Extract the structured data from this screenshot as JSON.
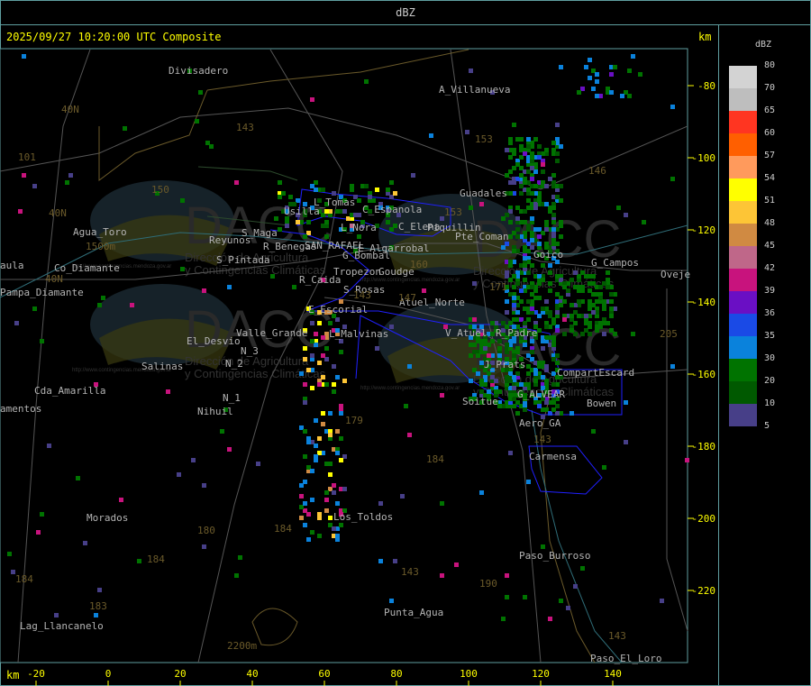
{
  "header": {
    "title": "dBZ"
  },
  "map": {
    "timestamp": "2025/09/27 10:20:00 UTC Composite",
    "unit_top": "km",
    "unit_bottom": "km",
    "x_ticks": [
      "-20",
      "0",
      "20",
      "40",
      "60",
      "80",
      "100",
      "120",
      "140"
    ],
    "y_ticks": [
      "-80",
      "-100",
      "-120",
      "-140",
      "-160",
      "-180",
      "-200",
      "-220"
    ],
    "watermark": {
      "logo": "DACC",
      "line1": "Dirección de Agricultura",
      "line2": "y Contingencias Climáticas",
      "url": "http://www.contingencias.mendoza.gov.ar"
    },
    "places": [
      "Divisadero",
      "A_Villanueva",
      "40N",
      "101",
      "143",
      "153",
      "146",
      "150",
      "Guadales",
      "40N",
      "40N",
      "Agua_Toro",
      "1500m",
      "Reyunos",
      "L_Nora",
      "C_Espanola",
      "Usilla",
      "L_Tomas",
      "C_Elena",
      "Piquillin",
      "Pte_Coman",
      "SAN_RAFAEL",
      "E_Algarrobal",
      "G_Bombal",
      "R_Benegas",
      "S_Pintada",
      "Tropezon",
      "Goudge",
      "R_Caida",
      "S_Rosas",
      "G_Campos",
      "Oveje",
      "Atuel_Norte",
      "E_Escorial",
      "Valle_Grande",
      "L_Malvinas",
      "El_Desvio",
      "V_Atuel",
      "R_Padre",
      "J_Prats",
      "CompartEscard",
      "Salinas",
      "N_2",
      "N_3",
      "N_1",
      "Nihuil",
      "Cda_Amarilla",
      "amentos",
      "Pampa_Diamante",
      "aula",
      "Co_Diamante",
      "Soitue",
      "G_ALVEAR",
      "Bowen",
      "Aero_GA",
      "Carmensa",
      "Los_Toldos",
      "Morados",
      "Paso_Burroso",
      "Punta_Agua",
      "Lag_Llancanelo",
      "2200m",
      "Paso_El_Loro",
      "179",
      "184",
      "180",
      "184",
      "184",
      "183",
      "143",
      "143",
      "190",
      "143",
      "184",
      "205",
      "160",
      "171",
      "147",
      "143",
      "153",
      "Goico",
      "S_Maga"
    ]
  },
  "legend": {
    "title": "dBZ",
    "items": [
      {
        "label": "80",
        "color": "#d3d3d3"
      },
      {
        "label": "70",
        "color": "#bebebe"
      },
      {
        "label": "65",
        "color": "#ff3521"
      },
      {
        "label": "60",
        "color": "#ff5f00"
      },
      {
        "label": "57",
        "color": "#ff9a5c"
      },
      {
        "label": "54",
        "color": "#ffff00"
      },
      {
        "label": "51",
        "color": "#fdc536"
      },
      {
        "label": "48",
        "color": "#d08a42"
      },
      {
        "label": "45",
        "color": "#bf6789"
      },
      {
        "label": "42",
        "color": "#c8137d"
      },
      {
        "label": "39",
        "color": "#6a0fc4"
      },
      {
        "label": "36",
        "color": "#1a4ae6"
      },
      {
        "label": "35",
        "color": "#0a82dc"
      },
      {
        "label": "30",
        "color": "#007300"
      },
      {
        "label": "20",
        "color": "#005900"
      },
      {
        "label": "10",
        "color": "#473f88"
      },
      {
        "label": "5",
        "color": ""
      }
    ]
  }
}
